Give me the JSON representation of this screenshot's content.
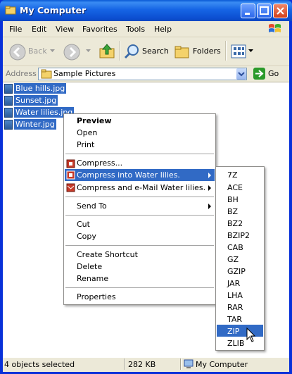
{
  "window": {
    "title": "My Computer"
  },
  "menubar": [
    "File",
    "Edit",
    "View",
    "Favorites",
    "Tools",
    "Help"
  ],
  "toolbar": {
    "back": "Back",
    "search": "Search",
    "folders": "Folders"
  },
  "address": {
    "label": "Address",
    "value": "Sample Pictures",
    "go": "Go"
  },
  "files": [
    "Blue hills.jpg",
    "Sunset.jpg",
    "Water lilies.jpg",
    "Winter.jpg"
  ],
  "context_menu": {
    "preview": "Preview",
    "open": "Open",
    "print": "Print",
    "compress": "Compress...",
    "compress_into": "Compress into Water lilies.",
    "compress_email": "Compress and e-Mail Water lilies.",
    "send_to": "Send To",
    "cut": "Cut",
    "copy": "Copy",
    "create_shortcut": "Create Shortcut",
    "delete": "Delete",
    "rename": "Rename",
    "properties": "Properties"
  },
  "submenu": [
    "7Z",
    "ACE",
    "BH",
    "BZ",
    "BZ2",
    "BZIP2",
    "CAB",
    "GZ",
    "GZIP",
    "JAR",
    "LHA",
    "RAR",
    "TAR",
    "ZIP",
    "ZLIB"
  ],
  "status": {
    "objects": "4 objects selected",
    "size": "282 KB",
    "location": "My Computer"
  },
  "colors": {
    "title_blue": "#0a47c2",
    "selection": "#316ac5",
    "chrome": "#ece9d8"
  }
}
